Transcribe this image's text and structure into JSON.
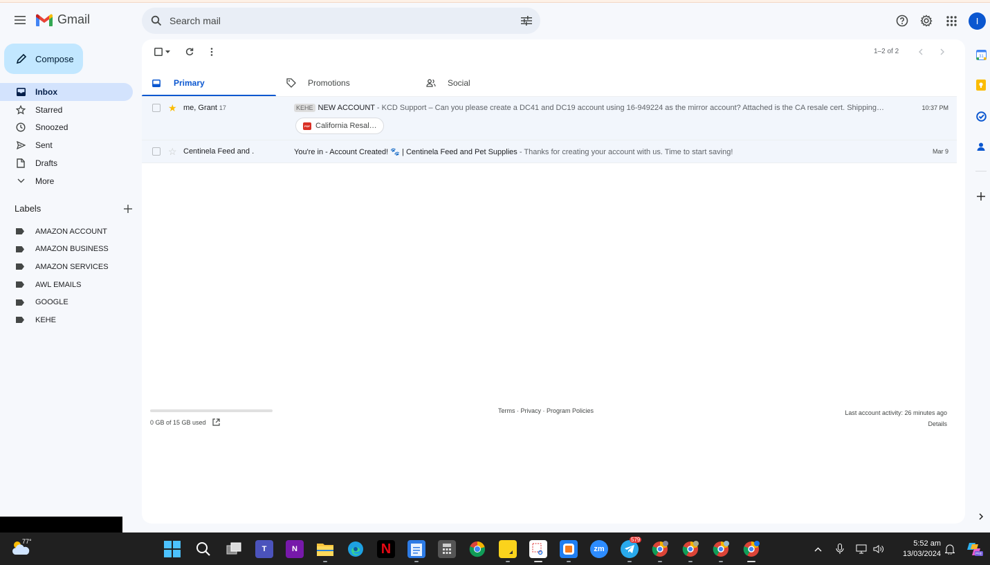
{
  "app": {
    "name": "Gmail"
  },
  "search": {
    "placeholder": "Search mail"
  },
  "compose": {
    "label": "Compose"
  },
  "nav": [
    {
      "label": "Inbox",
      "icon": "inbox-icon"
    },
    {
      "label": "Starred",
      "icon": "star-icon"
    },
    {
      "label": "Snoozed",
      "icon": "clock-icon"
    },
    {
      "label": "Sent",
      "icon": "send-icon"
    },
    {
      "label": "Drafts",
      "icon": "draft-icon"
    },
    {
      "label": "More",
      "icon": "chevron-down-icon"
    }
  ],
  "labels_header": "Labels",
  "labels": [
    "AMAZON ACCOUNT",
    "AMAZON BUSINESS",
    "AMAZON SERVICES",
    "AWL EMAILS",
    "GOOGLE",
    "KEHE"
  ],
  "toolbar": {
    "paging": "1–2 of 2"
  },
  "tabs": [
    {
      "label": "Primary"
    },
    {
      "label": "Promotions"
    },
    {
      "label": "Social"
    }
  ],
  "emails": [
    {
      "sender": "me, Grant",
      "count": "17",
      "badge": "KEHE",
      "subject": "NEW ACCOUNT",
      "snippet": " - KCD Support – Can you please create a DC41 and DC19 account using 16-949224 as the mirror account? Attached is the CA resale cert. Shipping…",
      "date": "10:37 PM",
      "starred": true,
      "attachment": "California Resal…"
    },
    {
      "sender": "Centinela Feed and .",
      "subject": "You're in - Account Created! 🐾 | Centinela Feed and Pet Supplies",
      "snippet": " - Thanks for creating your account with us. Time to start saving!",
      "date": "Mar 9",
      "starred": false
    }
  ],
  "footer": {
    "storage": "0 GB of 15 GB used",
    "links": "Terms · Privacy · Program Policies",
    "activity": "Last account activity: 26 minutes ago",
    "details": "Details"
  },
  "avatar_letter": "I",
  "taskbar": {
    "temperature": "77°",
    "time": "5:52 am",
    "date": "13/03/2024",
    "telegram_badge": "579"
  },
  "colors": {
    "accent": "#0b57d0",
    "star": "#fbbc04",
    "compose_bg": "#c2e7ff",
    "active_nav": "#d3e3fd"
  }
}
